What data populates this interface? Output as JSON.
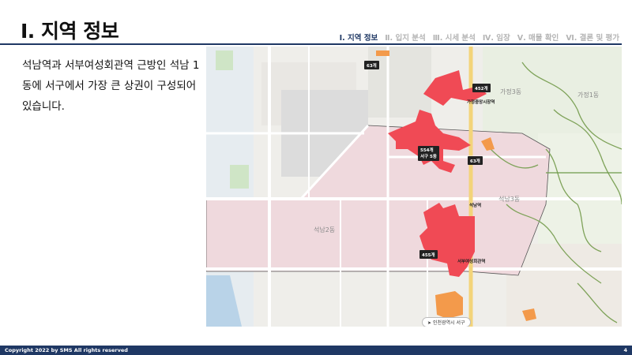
{
  "header": {
    "title": "Ⅰ. 지역 정보",
    "nav": [
      {
        "label": "Ⅰ. 지역 정보",
        "active": true
      },
      {
        "label": "Ⅱ. 입지 분석",
        "active": false
      },
      {
        "label": "Ⅲ. 시세 분석",
        "active": false
      },
      {
        "label": "Ⅳ. 임장",
        "active": false
      },
      {
        "label": "Ⅴ. 매물 확인",
        "active": false
      },
      {
        "label": "Ⅵ. 결론 및 평가",
        "active": false
      }
    ]
  },
  "description": "석남역과 서부여성회관역 근방인 석남 1동에 서구에서 가장 큰 상권이 구성되어 있습니다.",
  "map": {
    "pins": [
      "63개",
      "452개",
      "554개",
      "63개",
      "455개"
    ],
    "pin_sublabel": "서구 5동",
    "district_labels": [
      "석남2동",
      "석남3동",
      "가정3동",
      "가정1동"
    ],
    "stations": [
      "석남역",
      "서부여성회관역",
      "가정중앙시장역"
    ],
    "footer": "인천광역시 서구"
  },
  "footer": {
    "copyright": "Copyright 2022 by SMS All rights reserved",
    "page": "4"
  },
  "colors": {
    "accent": "#1f3864",
    "commercial": "#f04a55",
    "commercial_orange": "#f39a4b",
    "highlight_zone": "#efd9dd"
  }
}
